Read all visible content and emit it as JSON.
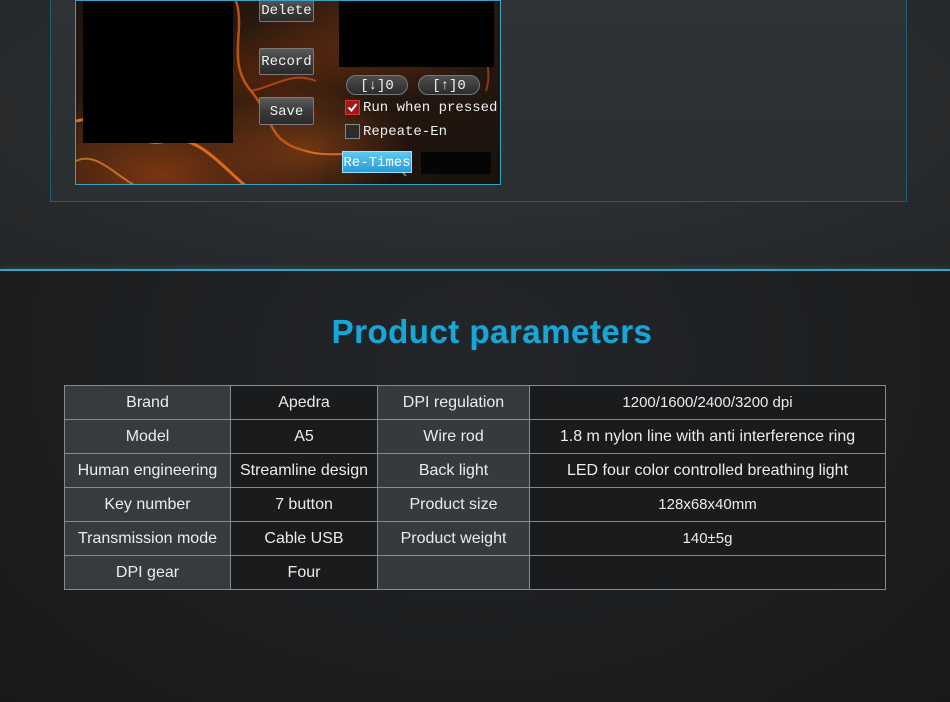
{
  "app_panel": {
    "buttons": {
      "delete": "Delete",
      "record": "Record",
      "save": "Save"
    },
    "counters": {
      "down": "[↓]0",
      "up": "[↑]0"
    },
    "options": {
      "run_when_pressed": {
        "label": "Run when pressed",
        "checked": true
      },
      "repeate_en": {
        "label": "Repeate-En",
        "checked": false
      }
    },
    "retimes_label": "Re-Times"
  },
  "section": {
    "title": "Product parameters"
  },
  "params_table": {
    "rows": [
      [
        "Brand",
        "Apedra",
        "DPI regulation",
        "1200/1600/2400/3200 dpi"
      ],
      [
        "Model",
        "A5",
        "Wire rod",
        "1.8 m nylon line with anti interference ring"
      ],
      [
        "Human engineering",
        "Streamline design",
        "Back light",
        "LED four color controlled breathing light"
      ],
      [
        "Key number",
        "7 button",
        "Product size",
        "128x68x40mm"
      ],
      [
        "Transmission mode",
        "Cable USB",
        "Product weight",
        "140±5g"
      ],
      [
        "DPI gear",
        "Four",
        "",
        ""
      ]
    ]
  },
  "colors": {
    "accent": "#19a6d6",
    "divider": "#2fa6c8",
    "check_on": "#a01818",
    "retimes_bg": "#3aa9e0"
  }
}
